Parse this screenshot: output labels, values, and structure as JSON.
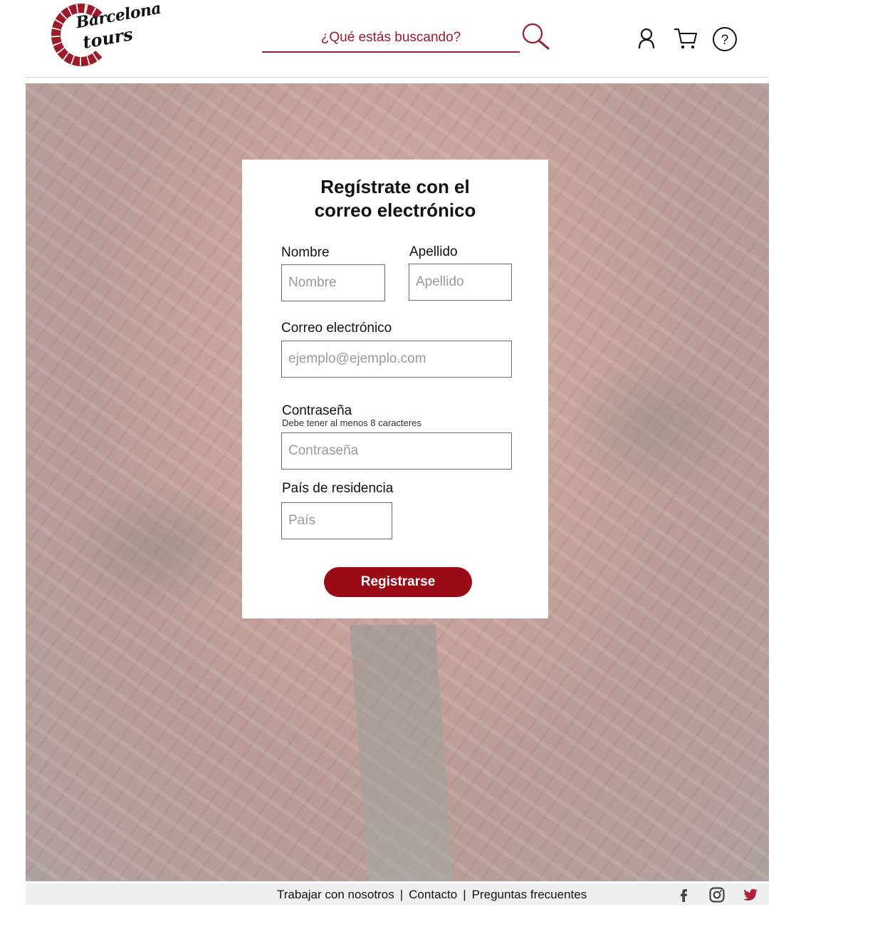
{
  "brand": {
    "line1": "Barcelona",
    "line2": "tours"
  },
  "search": {
    "placeholder": "¿Qué estás buscando?"
  },
  "header_icons": [
    "search-icon",
    "user-icon",
    "cart-icon",
    "help-icon"
  ],
  "form": {
    "title_line1": "Regístrate con el",
    "title_line2": "correo electrónico",
    "first_name": {
      "label": "Nombre",
      "placeholder": "Nombre",
      "value": ""
    },
    "last_name": {
      "label": "Apellido",
      "placeholder": "Apellido",
      "value": ""
    },
    "email": {
      "label": "Correo electrónico",
      "placeholder": "ejemplo@ejemplo.com",
      "value": ""
    },
    "password": {
      "label": "Contraseña",
      "hint": "Debe tener al menos 8 caracteres",
      "placeholder": "Contraseña",
      "value": ""
    },
    "country": {
      "label": "País de residencia",
      "placeholder": "País",
      "value": ""
    },
    "submit_label": "Registrarse"
  },
  "footer": {
    "links": [
      "Trabajar con nosotros",
      "Contacto",
      "Preguntas frecuentes"
    ],
    "separator": "|",
    "social": [
      "facebook-icon",
      "instagram-icon",
      "twitter-icon"
    ]
  },
  "colors": {
    "brand_red": "#9b1b2a",
    "button_red": "#9b0a17",
    "footer_bg": "#f0f0f0",
    "twitter_red": "#b0243a"
  }
}
